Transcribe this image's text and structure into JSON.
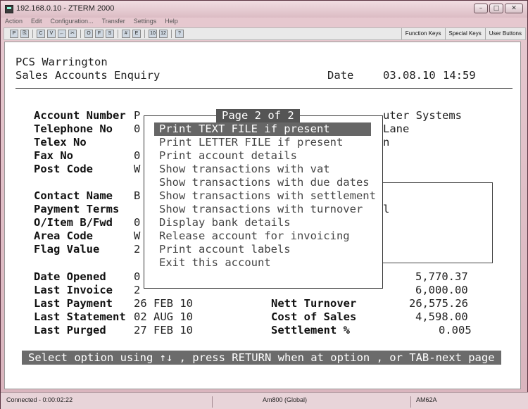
{
  "window": {
    "title": "192.168.0.10 - ZTERM 2000"
  },
  "menu": [
    "Action",
    "Edit",
    "Configuration...",
    "Transfer",
    "Settings",
    "Help"
  ],
  "toolbar": {
    "right_buttons": [
      "Function Keys",
      "Special Keys",
      "User Buttons"
    ],
    "icons": [
      "print-icon",
      "copy-icon",
      "paste-icon",
      "back-icon",
      "cut-icon",
      "open-icon",
      "save-icon",
      "grid-icon",
      "export-icon",
      "cols-10-icon",
      "cols-12-icon",
      "help-icon"
    ]
  },
  "terminal": {
    "company": "PCS Warrington",
    "screen_title": "Sales Accounts Enquiry",
    "date_label": "Date",
    "date": "03.08.10",
    "time": "14:59",
    "fields_left": [
      {
        "label": "Account Number",
        "value": "P"
      },
      {
        "label": "Telephone No",
        "value": "0"
      },
      {
        "label": "Telex No",
        "value": ""
      },
      {
        "label": "Fax No",
        "value": "0"
      },
      {
        "label": "Post Code",
        "value": "W"
      }
    ],
    "right_fragments": [
      "uter Systems",
      "Lane",
      "n"
    ],
    "fields_mid": [
      {
        "label": "Contact Name",
        "value": "B"
      },
      {
        "label": "Payment Terms",
        "value": ""
      },
      {
        "label": "O/Item B/Fwd",
        "value": "0"
      },
      {
        "label": "Area Code",
        "value": "W"
      },
      {
        "label": "Flag Value",
        "value": "2"
      }
    ],
    "mid_fragment": "l",
    "fields_bottom": [
      {
        "label": "Date Opened",
        "value": "0",
        "label2": "",
        "value2": "5,770.37"
      },
      {
        "label": "Last Invoice",
        "value": "2",
        "label2": "",
        "value2": "6,000.00"
      },
      {
        "label": "Last Payment",
        "value": "26 FEB 10",
        "label2": "Nett Turnover",
        "value2": "26,575.26"
      },
      {
        "label": "Last Statement",
        "value": "02 AUG 10",
        "label2": "Cost of Sales",
        "value2": "4,598.00"
      },
      {
        "label": "Last Purged",
        "value": "27 FEB 10",
        "label2": "Settlement %",
        "value2": "0.005"
      }
    ],
    "popup": {
      "title": "Page 2 of 2",
      "options": [
        "Print TEXT FILE if present",
        "Print LETTER FILE if present",
        "Print account details",
        "Show transactions with vat",
        "Show transactions with due dates",
        "Show transactions with settlement",
        "Show transactions with turnover",
        "Display bank details",
        "Release account for invoicing",
        "Print account labels",
        "Exit this account"
      ],
      "selected_index": 0
    },
    "status_line": "Select option using ↑↓ , press RETURN when at option , or TAB-next page"
  },
  "statusbar": {
    "connection": "Connected - 0:00:02:22",
    "emulation": "Am800 (Global)",
    "model": "AM62A"
  }
}
